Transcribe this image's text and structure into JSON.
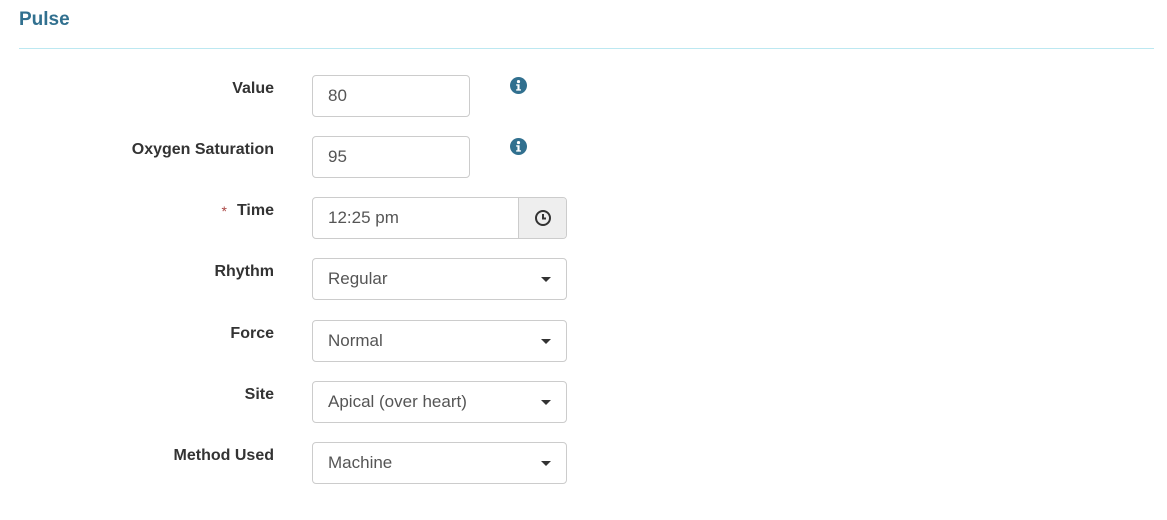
{
  "section": {
    "title": "Pulse"
  },
  "fields": {
    "value": {
      "label": "Value",
      "value": "80",
      "info_icon": "info-circle-icon"
    },
    "oxygen_saturation": {
      "label": "Oxygen Saturation",
      "value": "95",
      "info_icon": "info-circle-icon"
    },
    "time": {
      "label": "Time",
      "required_marker": "*",
      "value": "12:25 pm",
      "addon_icon": "clock-icon"
    },
    "rhythm": {
      "label": "Rhythm",
      "selected": "Regular"
    },
    "force": {
      "label": "Force",
      "selected": "Normal"
    },
    "site": {
      "label": "Site",
      "selected": "Apical (over heart)"
    },
    "method_used": {
      "label": "Method Used",
      "selected": "Machine"
    }
  },
  "colors": {
    "title": "#31708f",
    "divider": "#bce8f1",
    "required": "#a94442",
    "info_icon": "#31708f"
  }
}
